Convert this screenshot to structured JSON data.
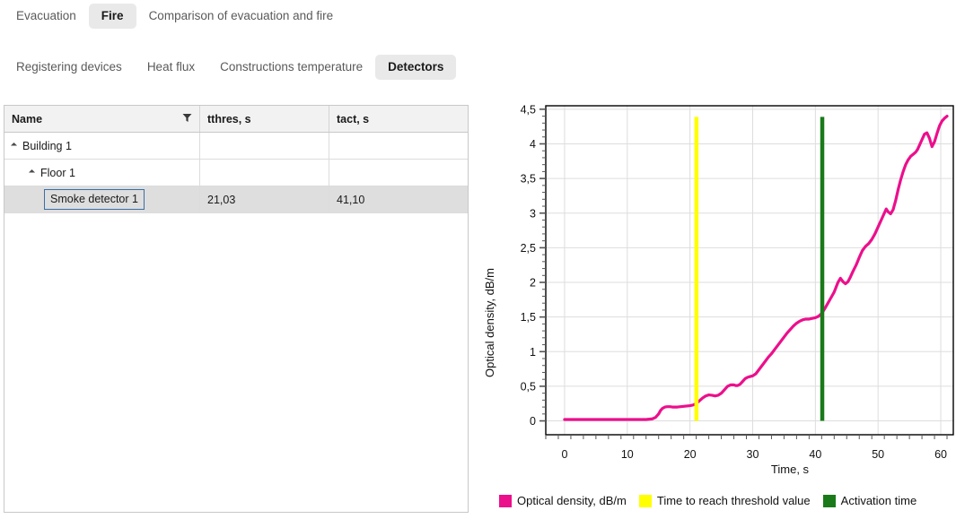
{
  "primary_tabs": [
    {
      "label": "Evacuation",
      "active": false
    },
    {
      "label": "Fire",
      "active": true
    },
    {
      "label": "Comparison of evacuation and fire",
      "active": false
    }
  ],
  "secondary_tabs": [
    {
      "label": "Registering devices",
      "active": false
    },
    {
      "label": "Heat flux",
      "active": false
    },
    {
      "label": "Constructions temperature",
      "active": false
    },
    {
      "label": "Detectors",
      "active": true
    }
  ],
  "table": {
    "columns": [
      {
        "key": "name",
        "label": "Name",
        "filter_icon": "filter-icon"
      },
      {
        "key": "tthres",
        "label": "tthres, s"
      },
      {
        "key": "tact",
        "label": "tact, s"
      }
    ],
    "rows": [
      {
        "level": 1,
        "expander": true,
        "name": "Building 1",
        "tthres": "",
        "tact": "",
        "selected": false
      },
      {
        "level": 2,
        "expander": true,
        "name": "Floor 1",
        "tthres": "",
        "tact": "",
        "selected": false
      },
      {
        "level": 3,
        "expander": false,
        "name": "Smoke detector 1",
        "tthres": "21,03",
        "tact": "41,10",
        "selected": true
      }
    ]
  },
  "chart_data": {
    "type": "line",
    "title": "",
    "xlabel": "Time, s",
    "ylabel": "Optical density, dB/m",
    "xlim": [
      -3,
      62
    ],
    "ylim": [
      -0.2,
      4.55
    ],
    "xticks": [
      0,
      10,
      20,
      30,
      40,
      50,
      60
    ],
    "xtick_labels": [
      "0",
      "10",
      "20",
      "30",
      "40",
      "50",
      "60"
    ],
    "yticks": [
      0,
      0.5,
      1,
      1.5,
      2,
      2.5,
      3,
      3.5,
      4,
      4.5
    ],
    "ytick_labels": [
      "0",
      "0,5",
      "1",
      "1,5",
      "2",
      "2,5",
      "3",
      "3,5",
      "4",
      "4,5"
    ],
    "xminor_step": 2,
    "yminor_step": 0.1,
    "grid": true,
    "legend_position": "bottom",
    "colors": {
      "optical_density": "#ec0f8c",
      "threshold_time": "#ffff00",
      "activation_time": "#1a7a1a",
      "grid": "#dddddd",
      "axis": "#000000"
    },
    "legend": [
      {
        "label": "Optical density, dB/m",
        "color": "#ec0f8c"
      },
      {
        "label": "Time to reach threshold value",
        "color": "#ffff00"
      },
      {
        "label": "Activation time",
        "color": "#1a7a1a"
      }
    ],
    "markers": [
      {
        "name": "Time to reach threshold value",
        "x": 21.03,
        "y_top": 4.39,
        "color": "#ffff00"
      },
      {
        "name": "Activation time",
        "x": 41.1,
        "y_top": 4.39,
        "color": "#1a7a1a"
      }
    ],
    "series": [
      {
        "name": "Optical density, dB/m",
        "color": "#ec0f8c",
        "x": [
          0,
          1,
          2,
          3,
          4,
          5,
          6,
          7,
          8,
          9,
          10,
          11,
          12,
          13,
          14,
          14.5,
          15,
          15.3,
          15.6,
          16,
          16.4,
          16.8,
          17.2,
          17.6,
          18,
          18.5,
          19,
          19.5,
          20,
          20.5,
          21,
          21.5,
          22,
          22.5,
          23,
          23.5,
          24,
          24.5,
          25,
          25.5,
          26,
          26.5,
          27,
          27.3,
          27.6,
          28,
          28.4,
          28.8,
          29.2,
          29.6,
          30,
          30.5,
          31,
          31.5,
          32,
          32.5,
          33,
          33.5,
          34,
          34.5,
          35,
          35.5,
          36,
          36.5,
          37,
          37.5,
          38,
          38.5,
          39,
          39.5,
          40,
          40.5,
          41,
          41.5,
          42,
          42.5,
          43,
          43.3,
          43.6,
          44,
          44.4,
          44.8,
          45.2,
          45.6,
          46,
          46.5,
          47,
          47.5,
          48,
          48.5,
          49,
          49.5,
          50,
          50.5,
          51,
          51.3,
          51.6,
          52,
          52.4,
          52.8,
          53.2,
          53.6,
          54,
          54.4,
          54.8,
          55.2,
          55.6,
          56,
          56.3,
          56.6,
          57,
          57.4,
          57.8,
          58.2,
          58.6,
          59,
          59.4,
          59.8,
          60.2,
          60.6,
          61
        ],
        "y": [
          0.02,
          0.02,
          0.02,
          0.02,
          0.02,
          0.02,
          0.02,
          0.02,
          0.02,
          0.02,
          0.02,
          0.02,
          0.02,
          0.02,
          0.03,
          0.05,
          0.1,
          0.15,
          0.18,
          0.2,
          0.205,
          0.205,
          0.2,
          0.2,
          0.2,
          0.205,
          0.21,
          0.215,
          0.22,
          0.23,
          0.25,
          0.29,
          0.33,
          0.36,
          0.375,
          0.37,
          0.36,
          0.37,
          0.4,
          0.45,
          0.5,
          0.52,
          0.52,
          0.51,
          0.51,
          0.53,
          0.57,
          0.61,
          0.63,
          0.64,
          0.65,
          0.68,
          0.74,
          0.8,
          0.86,
          0.92,
          0.97,
          1.03,
          1.09,
          1.15,
          1.21,
          1.27,
          1.32,
          1.37,
          1.41,
          1.44,
          1.46,
          1.47,
          1.47,
          1.48,
          1.49,
          1.51,
          1.55,
          1.62,
          1.7,
          1.78,
          1.86,
          1.93,
          2.0,
          2.06,
          2.01,
          1.98,
          2.01,
          2.08,
          2.16,
          2.25,
          2.36,
          2.46,
          2.52,
          2.56,
          2.62,
          2.7,
          2.8,
          2.9,
          3.0,
          3.06,
          3.02,
          2.99,
          3.05,
          3.18,
          3.34,
          3.48,
          3.6,
          3.7,
          3.77,
          3.82,
          3.85,
          3.88,
          3.92,
          3.98,
          4.06,
          4.14,
          4.16,
          4.08,
          3.96,
          4.03,
          4.15,
          4.26,
          4.33,
          4.37,
          4.4
        ]
      }
    ]
  }
}
